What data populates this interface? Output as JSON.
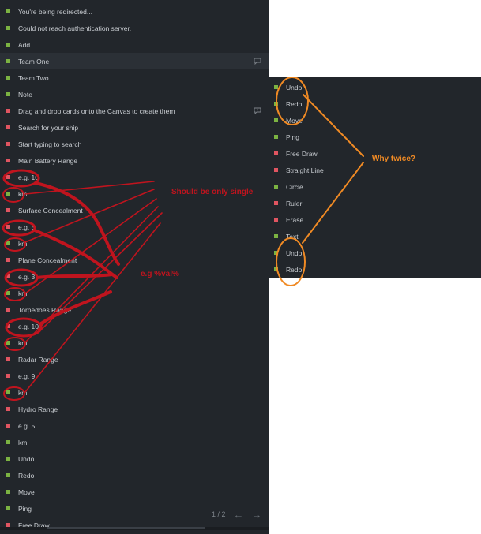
{
  "left_panel": {
    "items": [
      {
        "label": "You're being redirected...",
        "color": "green"
      },
      {
        "label": "Could not reach authentication server.",
        "color": "green"
      },
      {
        "label": "Add",
        "color": "green"
      },
      {
        "label": "Team One",
        "color": "green",
        "selected": true,
        "icon": "comment-icon"
      },
      {
        "label": "Team Two",
        "color": "green"
      },
      {
        "label": "Note",
        "color": "green"
      },
      {
        "label": "Drag and drop cards onto the Canvas to create them",
        "color": "red",
        "icon": "comment-alert-icon"
      },
      {
        "label": "Search for your ship",
        "color": "red"
      },
      {
        "label": "Start typing to search",
        "color": "red"
      },
      {
        "label": "Main Battery Range",
        "color": "red"
      },
      {
        "label": "e.g. 10",
        "color": "red"
      },
      {
        "label": "km",
        "color": "green"
      },
      {
        "label": "Surface Concealment",
        "color": "red"
      },
      {
        "label": "e.g. 5",
        "color": "red"
      },
      {
        "label": "km",
        "color": "green"
      },
      {
        "label": "Plane Concealment",
        "color": "red"
      },
      {
        "label": "e.g. 3",
        "color": "red"
      },
      {
        "label": "km",
        "color": "green"
      },
      {
        "label": "Torpedoes Range",
        "color": "red"
      },
      {
        "label": "e.g. 10",
        "color": "red"
      },
      {
        "label": "km",
        "color": "green"
      },
      {
        "label": "Radar Range",
        "color": "red"
      },
      {
        "label": "e.g. 9",
        "color": "red"
      },
      {
        "label": "km",
        "color": "green"
      },
      {
        "label": "Hydro Range",
        "color": "red"
      },
      {
        "label": "e.g. 5",
        "color": "red"
      },
      {
        "label": "km",
        "color": "green"
      },
      {
        "label": "Undo",
        "color": "green"
      },
      {
        "label": "Redo",
        "color": "green"
      },
      {
        "label": "Move",
        "color": "green"
      },
      {
        "label": "Ping",
        "color": "green"
      },
      {
        "label": "Free Draw",
        "color": "red"
      }
    ],
    "pager": {
      "text": "1 / 2",
      "prev": "←",
      "next": "→"
    }
  },
  "right_panel": {
    "items": [
      {
        "label": "Undo",
        "color": "green"
      },
      {
        "label": "Redo",
        "color": "green"
      },
      {
        "label": "Move",
        "color": "green"
      },
      {
        "label": "Ping",
        "color": "green"
      },
      {
        "label": "Free Draw",
        "color": "red"
      },
      {
        "label": "Straight Line",
        "color": "red"
      },
      {
        "label": "Circle",
        "color": "green"
      },
      {
        "label": "Ruler",
        "color": "red"
      },
      {
        "label": "Erase",
        "color": "red"
      },
      {
        "label": "Text",
        "color": "green"
      },
      {
        "label": "Undo",
        "color": "green"
      },
      {
        "label": "Redo",
        "color": "green"
      }
    ]
  },
  "annotations": {
    "single": "Should be only single",
    "val": "e.g %val%",
    "twice": "Why twice?"
  },
  "colors": {
    "panel_bg": "#22262b",
    "selected_bg": "#2b3036",
    "text": "#c9cdd2",
    "dot_green": "#7cb342",
    "dot_red": "#e05561",
    "ann_red": "#c0141e",
    "ann_orange": "#f08a24"
  }
}
